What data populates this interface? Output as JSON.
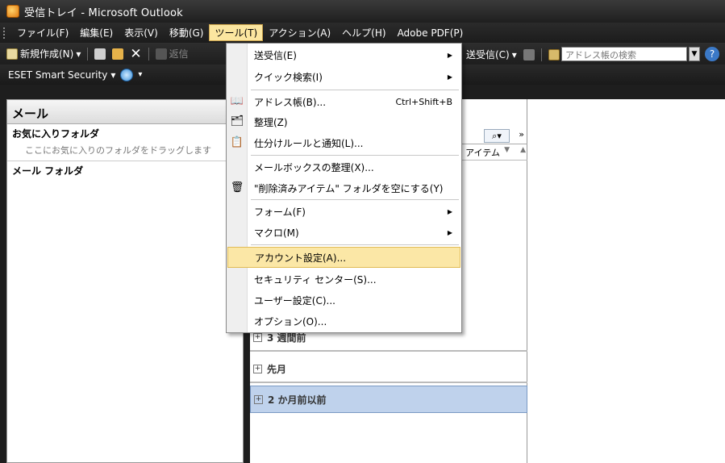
{
  "window": {
    "title": "受信トレイ - Microsoft Outlook"
  },
  "menubar": {
    "items": [
      "ファイル(F)",
      "編集(E)",
      "表示(V)",
      "移動(G)",
      "ツール(T)",
      "アクション(A)",
      "ヘルプ(H)",
      "Adobe PDF(P)"
    ]
  },
  "toolbar": {
    "new_label": "新規作成(N)",
    "reply_label": "返信",
    "sendrecv_label": "送受信(C)",
    "address_search_placeholder": "アドレス帳の検索"
  },
  "toolbar2": {
    "eset_label": "ESET Smart Security"
  },
  "nav": {
    "header": "メール",
    "favorites": "お気に入りフォルダ",
    "favorites_hint": "ここにお気に入りのフォルダをドラッグします",
    "mail_folders": "メール フォルダ"
  },
  "list": {
    "column_header": "アイテム",
    "groups": [
      {
        "label": "3 週間前",
        "selected": false
      },
      {
        "label": "先月",
        "selected": false
      },
      {
        "label": "2 か月前以前",
        "selected": true
      }
    ]
  },
  "tools_menu": {
    "items": [
      {
        "label": "送受信(E)",
        "submenu": true,
        "icon": ""
      },
      {
        "label": "クイック検索(I)",
        "submenu": true,
        "icon": ""
      },
      {
        "label": "アドレス帳(B)...",
        "shortcut": "Ctrl+Shift+B",
        "icon": "address-book-icon"
      },
      {
        "label": "整理(Z)",
        "icon": "organize-icon"
      },
      {
        "label": "仕分けルールと通知(L)...",
        "icon": "rules-icon"
      },
      {
        "label": "メールボックスの整理(X)...",
        "icon": ""
      },
      {
        "label": "\"削除済みアイテム\" フォルダを空にする(Y)",
        "icon": "empty-trash-icon"
      },
      {
        "label": "フォーム(F)",
        "submenu": true,
        "icon": ""
      },
      {
        "label": "マクロ(M)",
        "submenu": true,
        "icon": ""
      },
      {
        "label": "アカウント設定(A)...",
        "highlighted": true,
        "icon": ""
      },
      {
        "label": "セキュリティ センター(S)...",
        "icon": ""
      },
      {
        "label": "ユーザー設定(C)...",
        "icon": ""
      },
      {
        "label": "オプション(O)...",
        "icon": ""
      }
    ]
  },
  "colors": {
    "menu_highlight": "#fbe7a6",
    "selection": "#bfd2ec",
    "chrome_dark": "#1e1e1e"
  }
}
